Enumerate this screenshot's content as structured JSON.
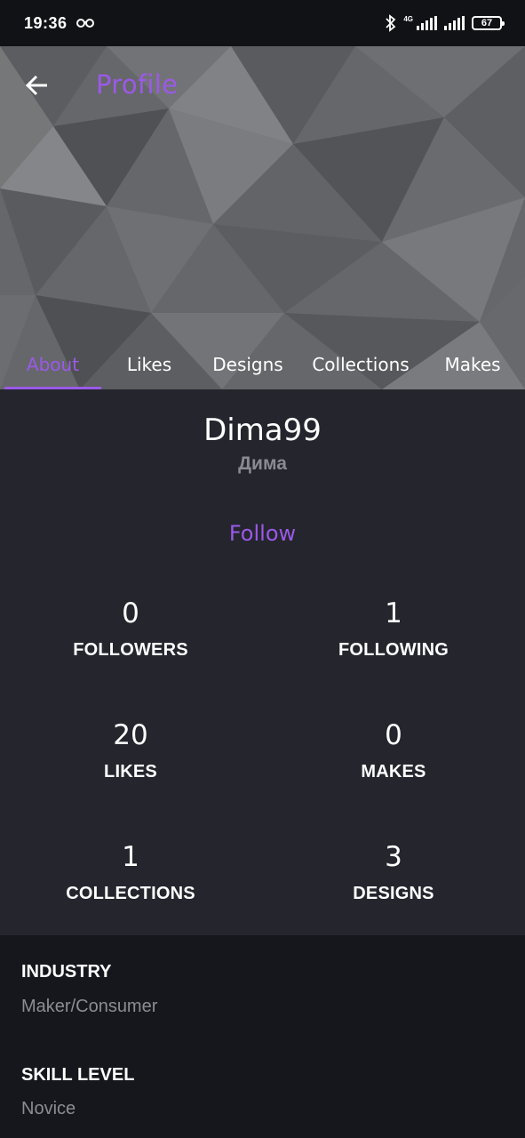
{
  "status_bar": {
    "time": "19:36",
    "network": "4G",
    "battery": "67",
    "icons": [
      "glasses-icon",
      "bluetooth-icon",
      "signal-icon",
      "signal-icon",
      "battery-icon"
    ]
  },
  "header": {
    "title": "Profile",
    "back_icon": "arrow-left-icon"
  },
  "tabs": [
    {
      "label": "About",
      "active": true
    },
    {
      "label": "Likes",
      "active": false
    },
    {
      "label": "Designs",
      "active": false
    },
    {
      "label": "Collections",
      "active": false
    },
    {
      "label": "Makes",
      "active": false
    }
  ],
  "profile": {
    "username": "Dima99",
    "real_name": "Дима",
    "follow_label": "Follow"
  },
  "stats": [
    {
      "value": "0",
      "label": "FOLLOWERS"
    },
    {
      "value": "1",
      "label": "FOLLOWING"
    },
    {
      "value": "20",
      "label": "LIKES"
    },
    {
      "value": "0",
      "label": "MAKES"
    },
    {
      "value": "1",
      "label": "COLLECTIONS"
    },
    {
      "value": "3",
      "label": "DESIGNS"
    }
  ],
  "info": {
    "industry_label": "INDUSTRY",
    "industry_value": "Maker/Consumer",
    "skill_label": "SKILL LEVEL",
    "skill_value": "Novice"
  },
  "colors": {
    "accent": "#9b59e8",
    "card_bg": "#24252d",
    "page_bg": "#16171c",
    "muted_text": "#8c8c94"
  }
}
